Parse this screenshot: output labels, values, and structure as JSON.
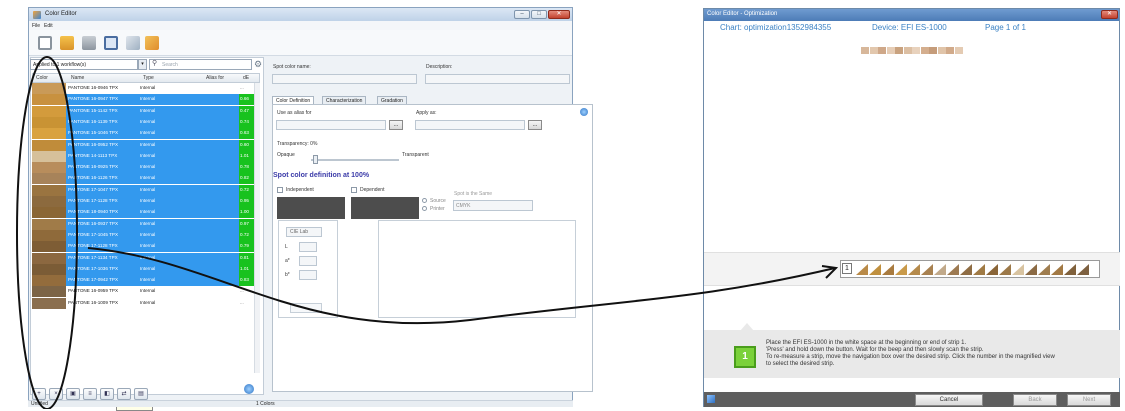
{
  "color_editor": {
    "title": "Color Editor",
    "menu": [
      "File",
      "Edit"
    ],
    "filter_value": "Applied to 1 workflow(s)",
    "search_placeholder": "Search",
    "columns": [
      "Color",
      "Name",
      "Type",
      "Alias for",
      "dE"
    ],
    "rows": [
      {
        "swatch": "#c99a58",
        "name": "PANTONE 16-0946 TPX",
        "type": "Internal",
        "de": "...",
        "selected": false
      },
      {
        "swatch": "#c8913f",
        "name": "PANTONE 16-0947 TPX",
        "type": "Internal",
        "de": "0.66",
        "selected": true
      },
      {
        "swatch": "#d39b3c",
        "name": "PANTONE 15-1142 TPX",
        "type": "Internal",
        "de": "0.47",
        "selected": true
      },
      {
        "swatch": "#c99334",
        "name": "PANTONE 16-1139 TPX",
        "type": "Internal",
        "de": "0.74",
        "selected": true
      },
      {
        "swatch": "#d9a23f",
        "name": "PANTONE 15-1046 TPX",
        "type": "Internal",
        "de": "0.63",
        "selected": true
      },
      {
        "swatch": "#c08c3a",
        "name": "PANTONE 16-0952 TPX",
        "type": "Internal",
        "de": "0.60",
        "selected": true
      },
      {
        "swatch": "#d6c09a",
        "name": "PANTONE 14-1113 TPX",
        "type": "Internal",
        "de": "1.01",
        "selected": true
      },
      {
        "swatch": "#b88d5c",
        "name": "PANTONE 16-0925 TPX",
        "type": "Internal",
        "de": "0.78",
        "selected": true
      },
      {
        "swatch": "#a7835a",
        "name": "PANTONE 16-1126 TPX",
        "type": "Internal",
        "de": "0.82",
        "selected": true
      },
      {
        "swatch": "#9a7440",
        "name": "PANTONE 17-1047 TPX",
        "type": "Internal",
        "de": "0.72",
        "selected": true
      },
      {
        "swatch": "#8c6a3e",
        "name": "PANTONE 17-1128 TPX",
        "type": "Internal",
        "de": "0.95",
        "selected": true
      },
      {
        "swatch": "#8a6635",
        "name": "PANTONE 18-0940 TPX",
        "type": "Internal",
        "de": "1.00",
        "selected": true
      },
      {
        "swatch": "#a07b48",
        "name": "PANTONE 16-0937 TPX",
        "type": "Internal",
        "de": "0.97",
        "selected": true
      },
      {
        "swatch": "#8f6a3a",
        "name": "PANTONE 17-1045 TPX",
        "type": "Internal",
        "de": "0.72",
        "selected": true
      },
      {
        "swatch": "#7e5d35",
        "name": "PANTONE 17-1128 TPX",
        "type": "Internal",
        "de": "0.79",
        "selected": true
      },
      {
        "swatch": "#8c6840",
        "name": "PANTONE 17-1134 TPX",
        "type": "Internal",
        "de": "0.81",
        "selected": true
      },
      {
        "swatch": "#7b5c36",
        "name": "PANTONE 17-1036 TPX",
        "type": "Internal",
        "de": "1.01",
        "selected": true
      },
      {
        "swatch": "#936c3c",
        "name": "PANTONE 17-0942 TPX",
        "type": "Internal",
        "de": "0.83",
        "selected": true
      },
      {
        "swatch": "#7c6446",
        "name": "PANTONE 16-0959 TPX",
        "type": "Internal",
        "de": "...",
        "selected": false
      },
      {
        "swatch": "#8a6e4e",
        "name": "PANTONE 16-1009 TPX",
        "type": "Internal",
        "de": "...",
        "selected": false
      }
    ],
    "tooltip": "Gamut check",
    "status_left": "Untitled",
    "status_right": "1 Colors",
    "spot_color_name_label": "Spot color name:",
    "description_label": "Description:",
    "tabs": [
      "Color Definition",
      "Characterization",
      "Gradation"
    ],
    "use_as_alias_label": "Use as alias for",
    "apply_as_label": "Apply as:",
    "browse_label": "...",
    "transparency_label": "Transparency: 0%",
    "opaque_label": "Opaque",
    "transparent_label": "Transparent",
    "spot_definition_title": "Spot color definition at 100%",
    "independent_label": "Independent",
    "dependent_label": "Dependent",
    "source_label": "Source",
    "printer_label": "Printer",
    "same_as_label": "Spot is the Same",
    "cmyk_value": "CMYK",
    "colorspace_value": "CIE Lab",
    "lab_labels": [
      "L",
      "a*",
      "b*"
    ]
  },
  "optimization": {
    "title": "Color Editor - Optimization",
    "chart_label": "Chart: optimization1352984355",
    "device_label": "Device: EFI ES-1000",
    "page_label": "Page 1 of 1",
    "strip_number": "1",
    "step_number": "1",
    "instructions": [
      "Place the EFI ES-1000 in the white space at the beginning or end of strip 1.",
      "'Press' and hold down the button. Wait for the beep and then slowly scan the strip.",
      "To re-measure a strip, move the navigation box over the desired strip. Click the number in the magnified view",
      "to select the desired strip."
    ],
    "cancel_label": "Cancel",
    "back_label": "Back",
    "next_label": "Next",
    "strip_colors": [
      "#b98a48",
      "#c0903f",
      "#a97b3f",
      "#c99a4a",
      "#b58a4b",
      "#a88150",
      "#c1a98a",
      "#9d7a52",
      "#8f6d44",
      "#a07a44",
      "#8a6538",
      "#9c7949",
      "#d8c3a0",
      "#8b6a44",
      "#9f7d4f",
      "#a27944",
      "#80613c",
      "#7d6040"
    ],
    "patch_colors": [
      "#d7b79a",
      "#e2c7ad",
      "#cfa889",
      "#e6cdb6",
      "#c9a27f",
      "#dcbfa3",
      "#e8d2bd",
      "#d4ae8e",
      "#c59c7a",
      "#e0c4a9",
      "#d1aa8a",
      "#e4cbb3"
    ]
  }
}
